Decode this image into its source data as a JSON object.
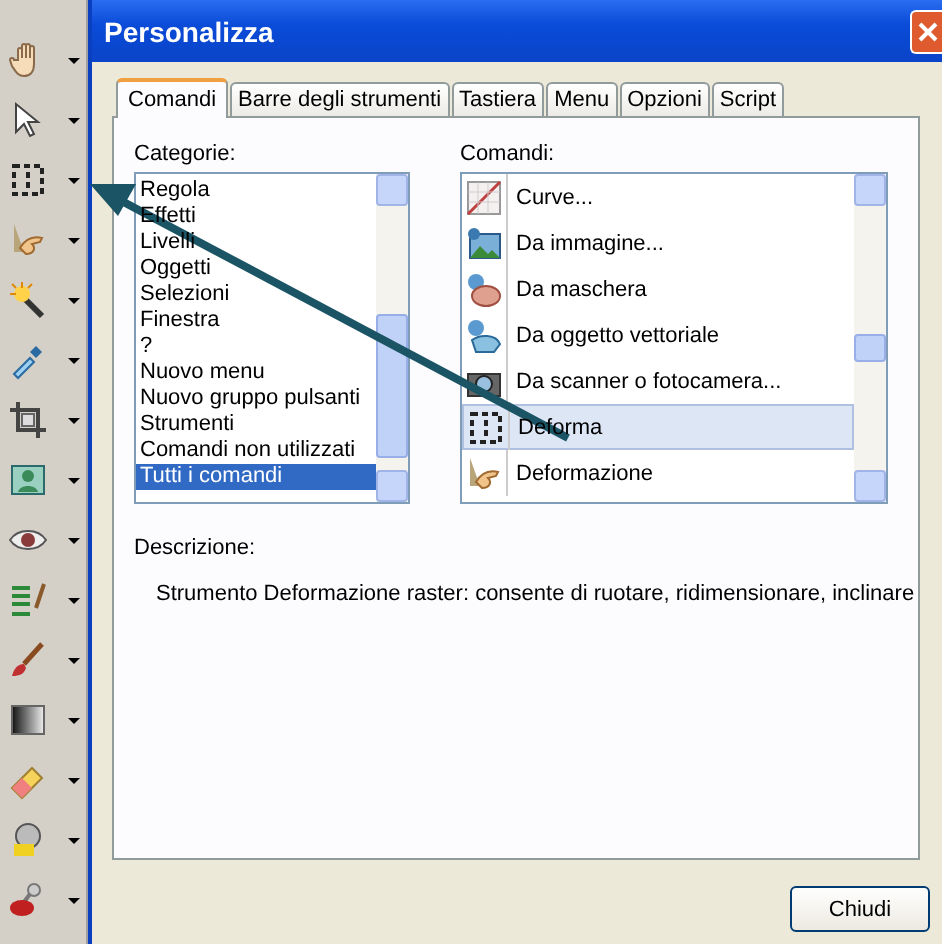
{
  "toolbar": {
    "tools": [
      {
        "kind": "hand"
      },
      {
        "kind": "pointer"
      },
      {
        "kind": "selection"
      },
      {
        "kind": "finger"
      },
      {
        "kind": "wand"
      },
      {
        "kind": "dropper"
      },
      {
        "kind": "crop"
      },
      {
        "kind": "photo"
      },
      {
        "kind": "eye"
      },
      {
        "kind": "layerbrush"
      },
      {
        "kind": "brush"
      },
      {
        "kind": "gradient"
      },
      {
        "kind": "eraser"
      },
      {
        "kind": "bucket"
      },
      {
        "kind": "stamp"
      }
    ]
  },
  "window": {
    "title": "Personalizza"
  },
  "tabs": [
    {
      "label": "Comandi",
      "selected": true
    },
    {
      "label": "Barre degli strumenti",
      "selected": false
    },
    {
      "label": "Tastiera",
      "selected": false
    },
    {
      "label": "Menu",
      "selected": false
    },
    {
      "label": "Opzioni",
      "selected": false
    },
    {
      "label": "Script",
      "selected": false
    }
  ],
  "categories": {
    "label": "Categorie:",
    "items": [
      {
        "label": "Regola",
        "selected": false
      },
      {
        "label": "Effetti",
        "selected": false
      },
      {
        "label": "Livelli",
        "selected": false
      },
      {
        "label": "Oggetti",
        "selected": false
      },
      {
        "label": "Selezioni",
        "selected": false
      },
      {
        "label": "Finestra",
        "selected": false
      },
      {
        "label": "?",
        "selected": false
      },
      {
        "label": "Nuovo menu",
        "selected": false
      },
      {
        "label": "Nuovo gruppo pulsanti",
        "selected": false
      },
      {
        "label": "Strumenti",
        "selected": false
      },
      {
        "label": "Comandi non utilizzati",
        "selected": false
      },
      {
        "label": "Tutti i comandi",
        "selected": true
      }
    ]
  },
  "commands": {
    "label": "Comandi:",
    "items": [
      {
        "kind": "curve",
        "label": "Curve...",
        "selected": false
      },
      {
        "kind": "image",
        "label": "Da immagine...",
        "selected": false
      },
      {
        "kind": "mask",
        "label": "Da maschera",
        "selected": false
      },
      {
        "kind": "vector",
        "label": "Da oggetto vettoriale",
        "selected": false
      },
      {
        "kind": "scanner",
        "label": "Da scanner o fotocamera...",
        "selected": false
      },
      {
        "kind": "selection",
        "label": "Deforma",
        "selected": true
      },
      {
        "kind": "finger",
        "label": "Deformazione",
        "selected": false
      }
    ]
  },
  "description": {
    "label": "Descrizione:",
    "text": "Strumento Deformazione raster: consente di ruotare, ridimensionare, inclinare"
  },
  "buttons": [
    {
      "label": "Chiudi"
    }
  ]
}
